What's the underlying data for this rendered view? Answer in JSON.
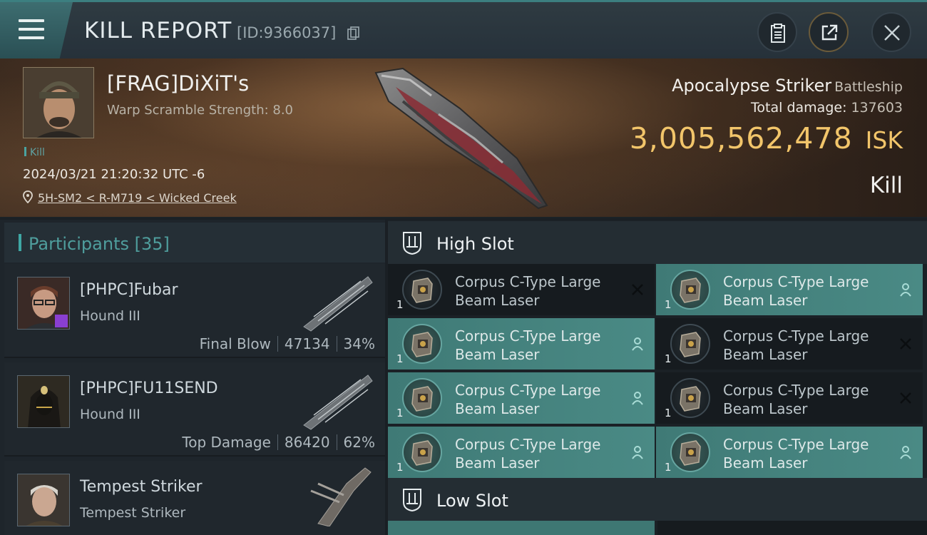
{
  "header": {
    "title": "KILL REPORT",
    "report_id": "[ID:9366037]",
    "icons": {
      "menu": "menu-icon",
      "copy": "copy-icon",
      "clipboard": "clipboard-icon",
      "share": "share-icon",
      "close": "close-icon"
    }
  },
  "victim": {
    "name": "[FRAG]DiXiT's",
    "subtitle": "Warp Scramble Strength: 8.0",
    "tag": "Kill",
    "datetime": "2024/03/21 21:20:32 UTC -6",
    "location": "5H-SM2 < R-M719 < Wicked Creek",
    "ship_name": "Apocalypse Striker",
    "ship_class": "Battleship",
    "total_damage_label": "Total damage:",
    "total_damage": "137603",
    "isk_value": "3,005,562,478",
    "isk_unit": "ISK",
    "result": "Kill"
  },
  "participants": {
    "label": "Participants",
    "count": "[35]",
    "items": [
      {
        "name": "[PHPC]Fubar",
        "ship": "Hound III",
        "role": "Final Blow",
        "damage": "47134",
        "percent": "34%"
      },
      {
        "name": "[PHPC]FU11SEND",
        "ship": "Hound III",
        "role": "Top Damage",
        "damage": "86420",
        "percent": "62%"
      },
      {
        "name": "Tempest Striker",
        "ship": "Tempest Striker",
        "role": "",
        "damage": "",
        "percent": ""
      }
    ]
  },
  "high_slot": {
    "label": "High Slot",
    "modules": [
      {
        "qty": "1",
        "name": "Corpus C-Type Large Beam Laser",
        "state": "destroyed"
      },
      {
        "qty": "1",
        "name": "Corpus C-Type Large Beam Laser",
        "state": "dropped"
      },
      {
        "qty": "1",
        "name": "Corpus C-Type Large Beam Laser",
        "state": "dropped"
      },
      {
        "qty": "1",
        "name": "Corpus C-Type Large Beam Laser",
        "state": "destroyed"
      },
      {
        "qty": "1",
        "name": "Corpus C-Type Large Beam Laser",
        "state": "dropped"
      },
      {
        "qty": "1",
        "name": "Corpus C-Type Large Beam Laser",
        "state": "destroyed"
      },
      {
        "qty": "1",
        "name": "Corpus C-Type Large Beam Laser",
        "state": "dropped"
      },
      {
        "qty": "1",
        "name": "Corpus C-Type Large Beam Laser",
        "state": "dropped"
      }
    ]
  },
  "low_slot": {
    "label": "Low Slot"
  },
  "colors": {
    "accent_teal": "#3fa7a4",
    "dropped_bg": "#4a8a85",
    "destroyed_bg": "#161b1f",
    "isk_gold": "#f2c56a"
  }
}
